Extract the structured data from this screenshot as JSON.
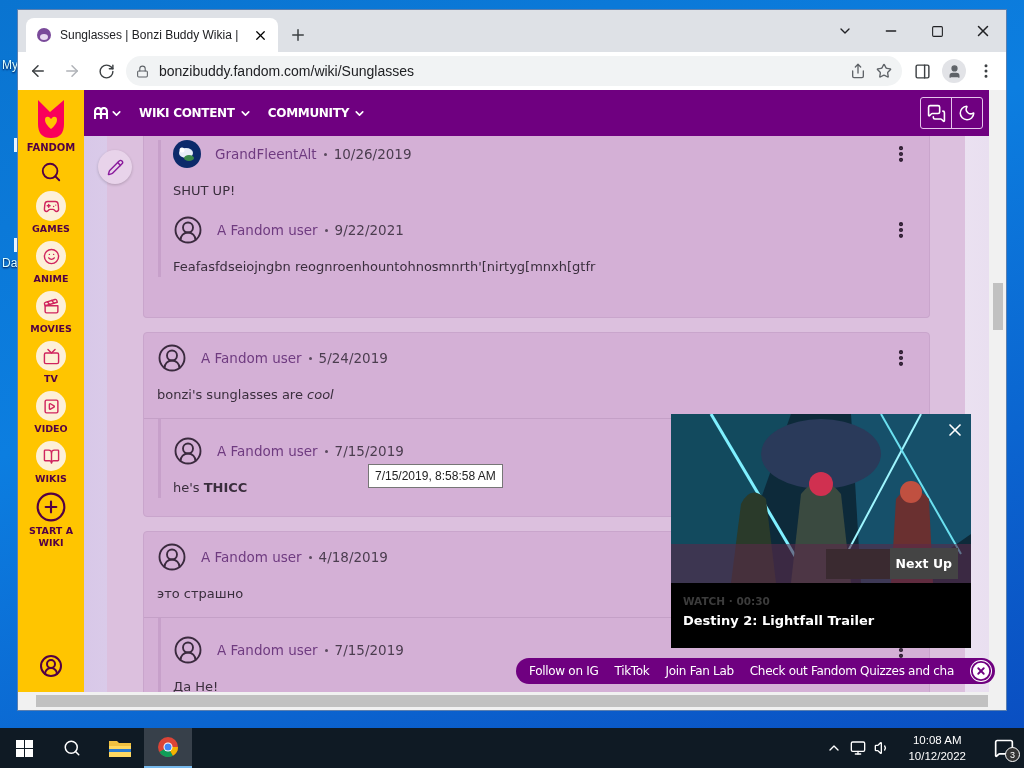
{
  "desktop": {
    "icon_labels": [
      "My",
      "Da"
    ]
  },
  "browser": {
    "tabs": [
      {
        "title": "Sunglasses | Bonzi Buddy Wikia |",
        "selected": true
      }
    ],
    "url": "bonzibuddy.fandom.com/wiki/Sunglasses"
  },
  "fandom_rail": {
    "brand": "FANDOM",
    "items": [
      {
        "kind": "games",
        "label": "GAMES"
      },
      {
        "kind": "anime",
        "label": "ANIME"
      },
      {
        "kind": "movies",
        "label": "MOVIES"
      },
      {
        "kind": "tv",
        "label": "TV"
      },
      {
        "kind": "video",
        "label": "VIDEO"
      },
      {
        "kind": "wikis",
        "label": "WIKIS"
      },
      {
        "kind": "start",
        "label": "START A WIKI"
      }
    ]
  },
  "wiki_nav": {
    "items": [
      "WIKI CONTENT",
      "COMMUNITY"
    ]
  },
  "threads": [
    {
      "replies": [
        {
          "author": "GrandFleentAlt",
          "date": "10/26/2019",
          "text": "SHUT UP!",
          "custom_avatar": true
        },
        {
          "author": "A Fandom user",
          "date": "9/22/2021",
          "text": "Feafasfdseiojngbn reognroenhountohnosmnrth'[nirtyg[mnxh[gtfr",
          "custom_avatar": false
        }
      ]
    },
    {
      "comment": {
        "author": "A Fandom user",
        "date": "5/24/2019",
        "text": "bonzi's sunglasses are *cool*",
        "custom_avatar": false
      },
      "replies": [
        {
          "author": "A Fandom user",
          "date": "7/15/2019",
          "text": "he's **THICC**",
          "custom_avatar": false
        }
      ]
    },
    {
      "comment": {
        "author": "A Fandom user",
        "date": "4/18/2019",
        "text": "это страшно",
        "custom_avatar": false
      },
      "replies": [
        {
          "author": "A Fandom user",
          "date": "7/15/2019",
          "text": "Да Не!",
          "custom_avatar": false
        }
      ]
    }
  ],
  "tooltip": "7/15/2019, 8:58:58 AM",
  "video": {
    "next_label": "Next Up",
    "eyebrow": "WATCH · 00:30",
    "title": "Destiny 2: Lightfall Trailer"
  },
  "social_bar": {
    "links": [
      "Follow on IG",
      "TikTok",
      "Join Fan Lab",
      "Check out Fandom Quizzes and cha"
    ]
  },
  "taskbar": {
    "time": "10:08 AM",
    "date": "10/12/2022",
    "notification_count": "3"
  }
}
